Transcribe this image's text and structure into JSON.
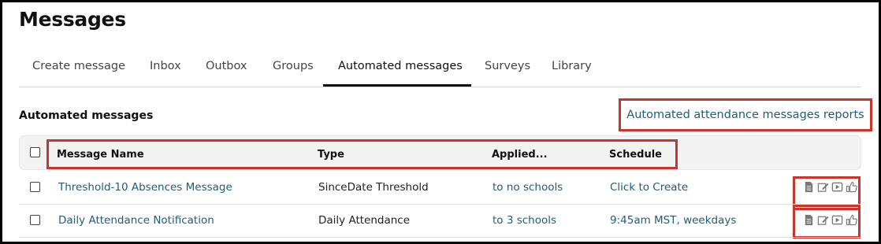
{
  "page": {
    "title": "Messages"
  },
  "tabs": [
    {
      "label": "Create message"
    },
    {
      "label": "Inbox"
    },
    {
      "label": "Outbox"
    },
    {
      "label": "Groups"
    },
    {
      "label": "Automated messages",
      "active": true
    },
    {
      "label": "Surveys"
    },
    {
      "label": "Library"
    }
  ],
  "section": {
    "title": "Automated messages",
    "report_link": "Automated attendance messages reports"
  },
  "table": {
    "columns": [
      "Message Name",
      "Type",
      "Applied...",
      "Schedule"
    ],
    "rows": [
      {
        "name": "Threshold-10 Absences Message",
        "type": "SinceDate Threshold",
        "applied": "to no schools",
        "schedule": "Click to Create",
        "actions": [
          "document-icon",
          "edit-icon",
          "play-icon",
          "thumbs-up-icon"
        ]
      },
      {
        "name": "Daily Attendance Notification",
        "type": "Daily Attendance",
        "applied": "to 3 schools",
        "schedule": "9:45am MST, weekdays",
        "actions": [
          "document-icon",
          "edit-icon",
          "play-icon",
          "thumbs-up-icon"
        ]
      }
    ]
  },
  "colors": {
    "link": "#1f5d7a",
    "highlight_box": "#c8352e",
    "header_bg": "#f3f3f3"
  }
}
